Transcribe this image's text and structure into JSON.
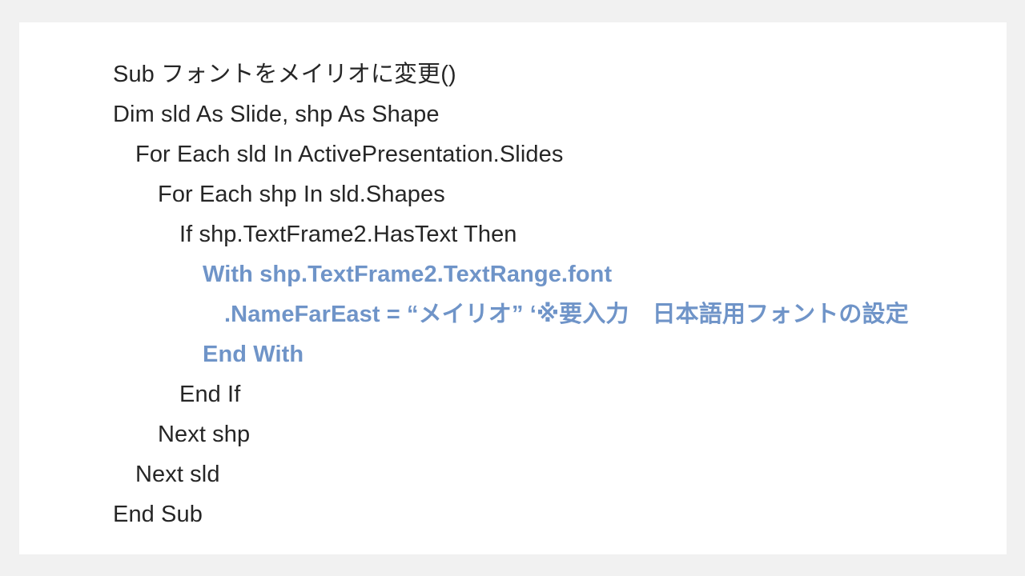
{
  "slide": {
    "background_color": "#f1f1f1",
    "canvas_color": "#ffffff",
    "text_color": "#262626",
    "highlight_color": "#6f94c8",
    "code_lines": [
      {
        "text": "Sub フォントをメイリオに変更()",
        "indent": 0,
        "highlight": false
      },
      {
        "text": "Dim sld As Slide, shp As Shape",
        "indent": 0,
        "highlight": false
      },
      {
        "text": "For Each sld In ActivePresentation.Slides",
        "indent": 1,
        "highlight": false
      },
      {
        "text": "For Each shp In sld.Shapes",
        "indent": 2,
        "highlight": false
      },
      {
        "text": "If shp.TextFrame2.HasText Then",
        "indent": 3,
        "highlight": false
      },
      {
        "text": "With shp.TextFrame2.TextRange.font",
        "indent": 4,
        "highlight": true
      },
      {
        "text": ".NameFarEast = “メイリオ” ‘※要入力　日本語用フォントの設定",
        "indent": 5,
        "highlight": true
      },
      {
        "text": "End With",
        "indent": 4,
        "highlight": true
      },
      {
        "text": "End If",
        "indent": 3,
        "highlight": false
      },
      {
        "text": "Next shp",
        "indent": 2,
        "highlight": false
      },
      {
        "text": "Next sld",
        "indent": 1,
        "highlight": false
      },
      {
        "text": "End Sub",
        "indent": 0,
        "highlight": false
      }
    ]
  }
}
